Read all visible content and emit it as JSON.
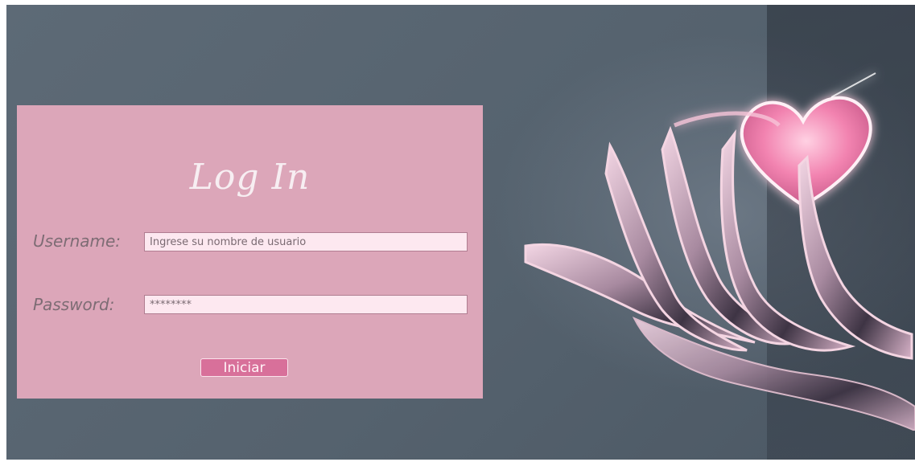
{
  "login": {
    "title": "Log In",
    "username_label": "Username:",
    "username_placeholder": "Ingrese su nombre de usuario",
    "password_label": "Password:",
    "password_value": "********",
    "submit_label": "Iniciar"
  },
  "colors": {
    "card_background": "#dca6b9",
    "input_background": "#fde8f0",
    "button_background": "#d8709a",
    "page_background": "#5a6672",
    "heart": "#f07aa8"
  },
  "background_image": {
    "subject": "hand-holding-heart"
  }
}
